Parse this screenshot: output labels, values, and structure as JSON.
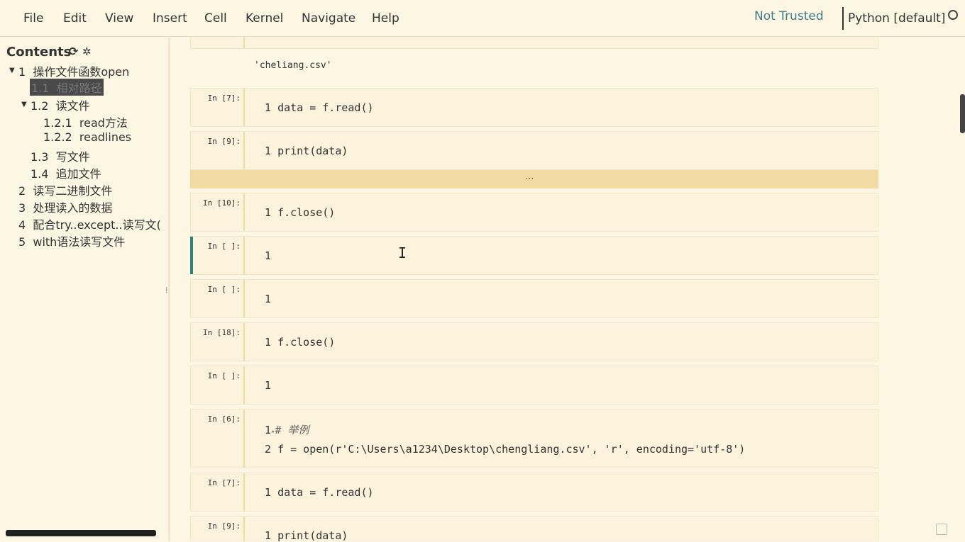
{
  "menu": [
    "File",
    "Edit",
    "View",
    "Insert",
    "Cell",
    "Kernel",
    "Navigate",
    "Help"
  ],
  "status": {
    "trusted": "Not Trusted",
    "kernel": "Python [default]"
  },
  "toc": {
    "header": "Contents",
    "refresh_icon": "refresh-icon",
    "settings_icon": "gear-icon",
    "items": [
      {
        "num": "1",
        "text": "操作文件函数open"
      },
      {
        "num": "1.1",
        "text": "相对路径"
      },
      {
        "num": "1.2",
        "text": "读文件"
      },
      {
        "num": "1.2.1",
        "text": "read方法"
      },
      {
        "num": "1.2.2",
        "text": "readlines"
      },
      {
        "num": "1.3",
        "text": "写文件"
      },
      {
        "num": "1.4",
        "text": "追加文件"
      },
      {
        "num": "2",
        "text": "读写二进制文件"
      },
      {
        "num": "3",
        "text": "处理读入的数据"
      },
      {
        "num": "4",
        "text": "配合try..except..读写文("
      },
      {
        "num": "5",
        "text": "with语法读写文件"
      }
    ]
  },
  "output": "'cheliang.csv'",
  "collapsed": "...",
  "cells": [
    {
      "prompt": "In [7]:",
      "lines": [
        "data = f.read()"
      ]
    },
    {
      "prompt": "In [9]:",
      "lines": [
        "print(data)"
      ]
    },
    {
      "prompt": "In [10]:",
      "lines": [
        "f.close()"
      ]
    },
    {
      "prompt": "In [ ]:",
      "lines": [
        ""
      ]
    },
    {
      "prompt": "In [ ]:",
      "lines": [
        ""
      ]
    },
    {
      "prompt": "In [18]:",
      "lines": [
        "f.close()"
      ]
    },
    {
      "prompt": "In [ ]:",
      "lines": [
        ""
      ]
    },
    {
      "prompt": "In [6]:",
      "lines": [
        "# 举例",
        "f = open(r'C:\\Users\\a1234\\Desktop\\chengliang.csv', 'r', encoding='utf-8')"
      ]
    },
    {
      "prompt": "In [7]:",
      "lines": [
        "data = f.read()"
      ]
    },
    {
      "prompt": "In [9]:",
      "lines": [
        "print(data)"
      ]
    }
  ]
}
